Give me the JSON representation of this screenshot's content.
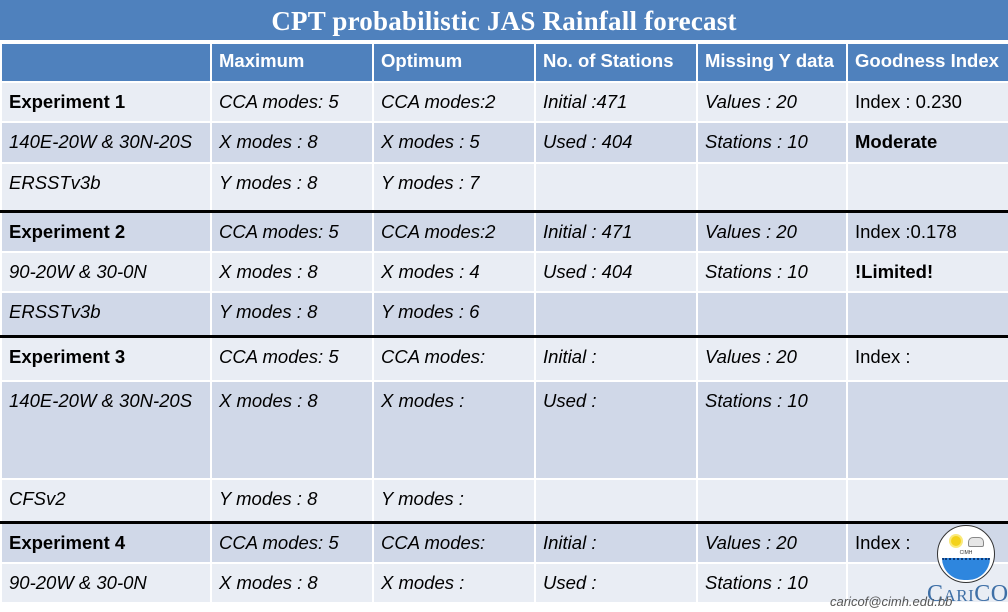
{
  "title": "CPT probabilistic JAS Rainfall forecast",
  "table": {
    "headers": [
      "",
      "Maximum",
      "Optimum",
      "No. of Stations",
      "Missing Y data",
      "Goodness Index"
    ],
    "experiments": [
      {
        "rows": [
          [
            "Experiment 1",
            "CCA modes: 5",
            "CCA modes:2",
            "Initial :471",
            "Values : 20",
            "Index : 0.230"
          ],
          [
            "140E-20W & 30N-20S",
            "X modes : 8",
            "X modes : 5",
            "Used : 404",
            "Stations : 10",
            "Moderate"
          ],
          [
            "ERSSTv3b",
            "Y modes : 8",
            "Y modes : 7",
            "",
            "",
            ""
          ]
        ]
      },
      {
        "rows": [
          [
            "Experiment 2",
            "CCA modes: 5",
            "CCA modes:2",
            "Initial : 471",
            "Values : 20",
            "Index :0.178"
          ],
          [
            "90-20W & 30-0N",
            "X modes : 8",
            "X modes : 4",
            "Used : 404",
            "Stations : 10",
            "!Limited!"
          ],
          [
            "ERSSTv3b",
            "Y modes : 8",
            "Y modes : 6",
            "",
            "",
            ""
          ]
        ]
      },
      {
        "rows": [
          [
            "Experiment 3",
            "CCA modes: 5",
            "CCA modes:",
            "Initial :",
            "Values : 20",
            "Index :"
          ],
          [
            "140E-20W & 30N-20S",
            "X modes : 8",
            "X modes :",
            "Used :",
            "Stations : 10",
            ""
          ],
          [
            "CFSv2",
            "Y modes : 8",
            "Y modes :",
            "",
            "",
            ""
          ]
        ]
      },
      {
        "rows": [
          [
            "Experiment 4",
            "CCA modes: 5",
            "CCA modes:",
            "Initial :",
            "Values : 20",
            "Index :"
          ],
          [
            "90-20W & 30-0N",
            "X modes : 8",
            "X modes :",
            "Used :",
            "Stations : 10",
            ""
          ]
        ]
      }
    ]
  },
  "logo": {
    "icon": "cimh-seal-icon",
    "caption": "CIMH",
    "brand_text_first": "C",
    "brand_text_middle": "ARI",
    "brand_text_last": "COF"
  },
  "watermark": "caricof@cimh.edu.bb",
  "colors": {
    "header_blue": "#4F81BD",
    "row_light": "#E9EDF4",
    "row_dark": "#D0D8E8",
    "brand_blue": "#3E6FA6"
  }
}
